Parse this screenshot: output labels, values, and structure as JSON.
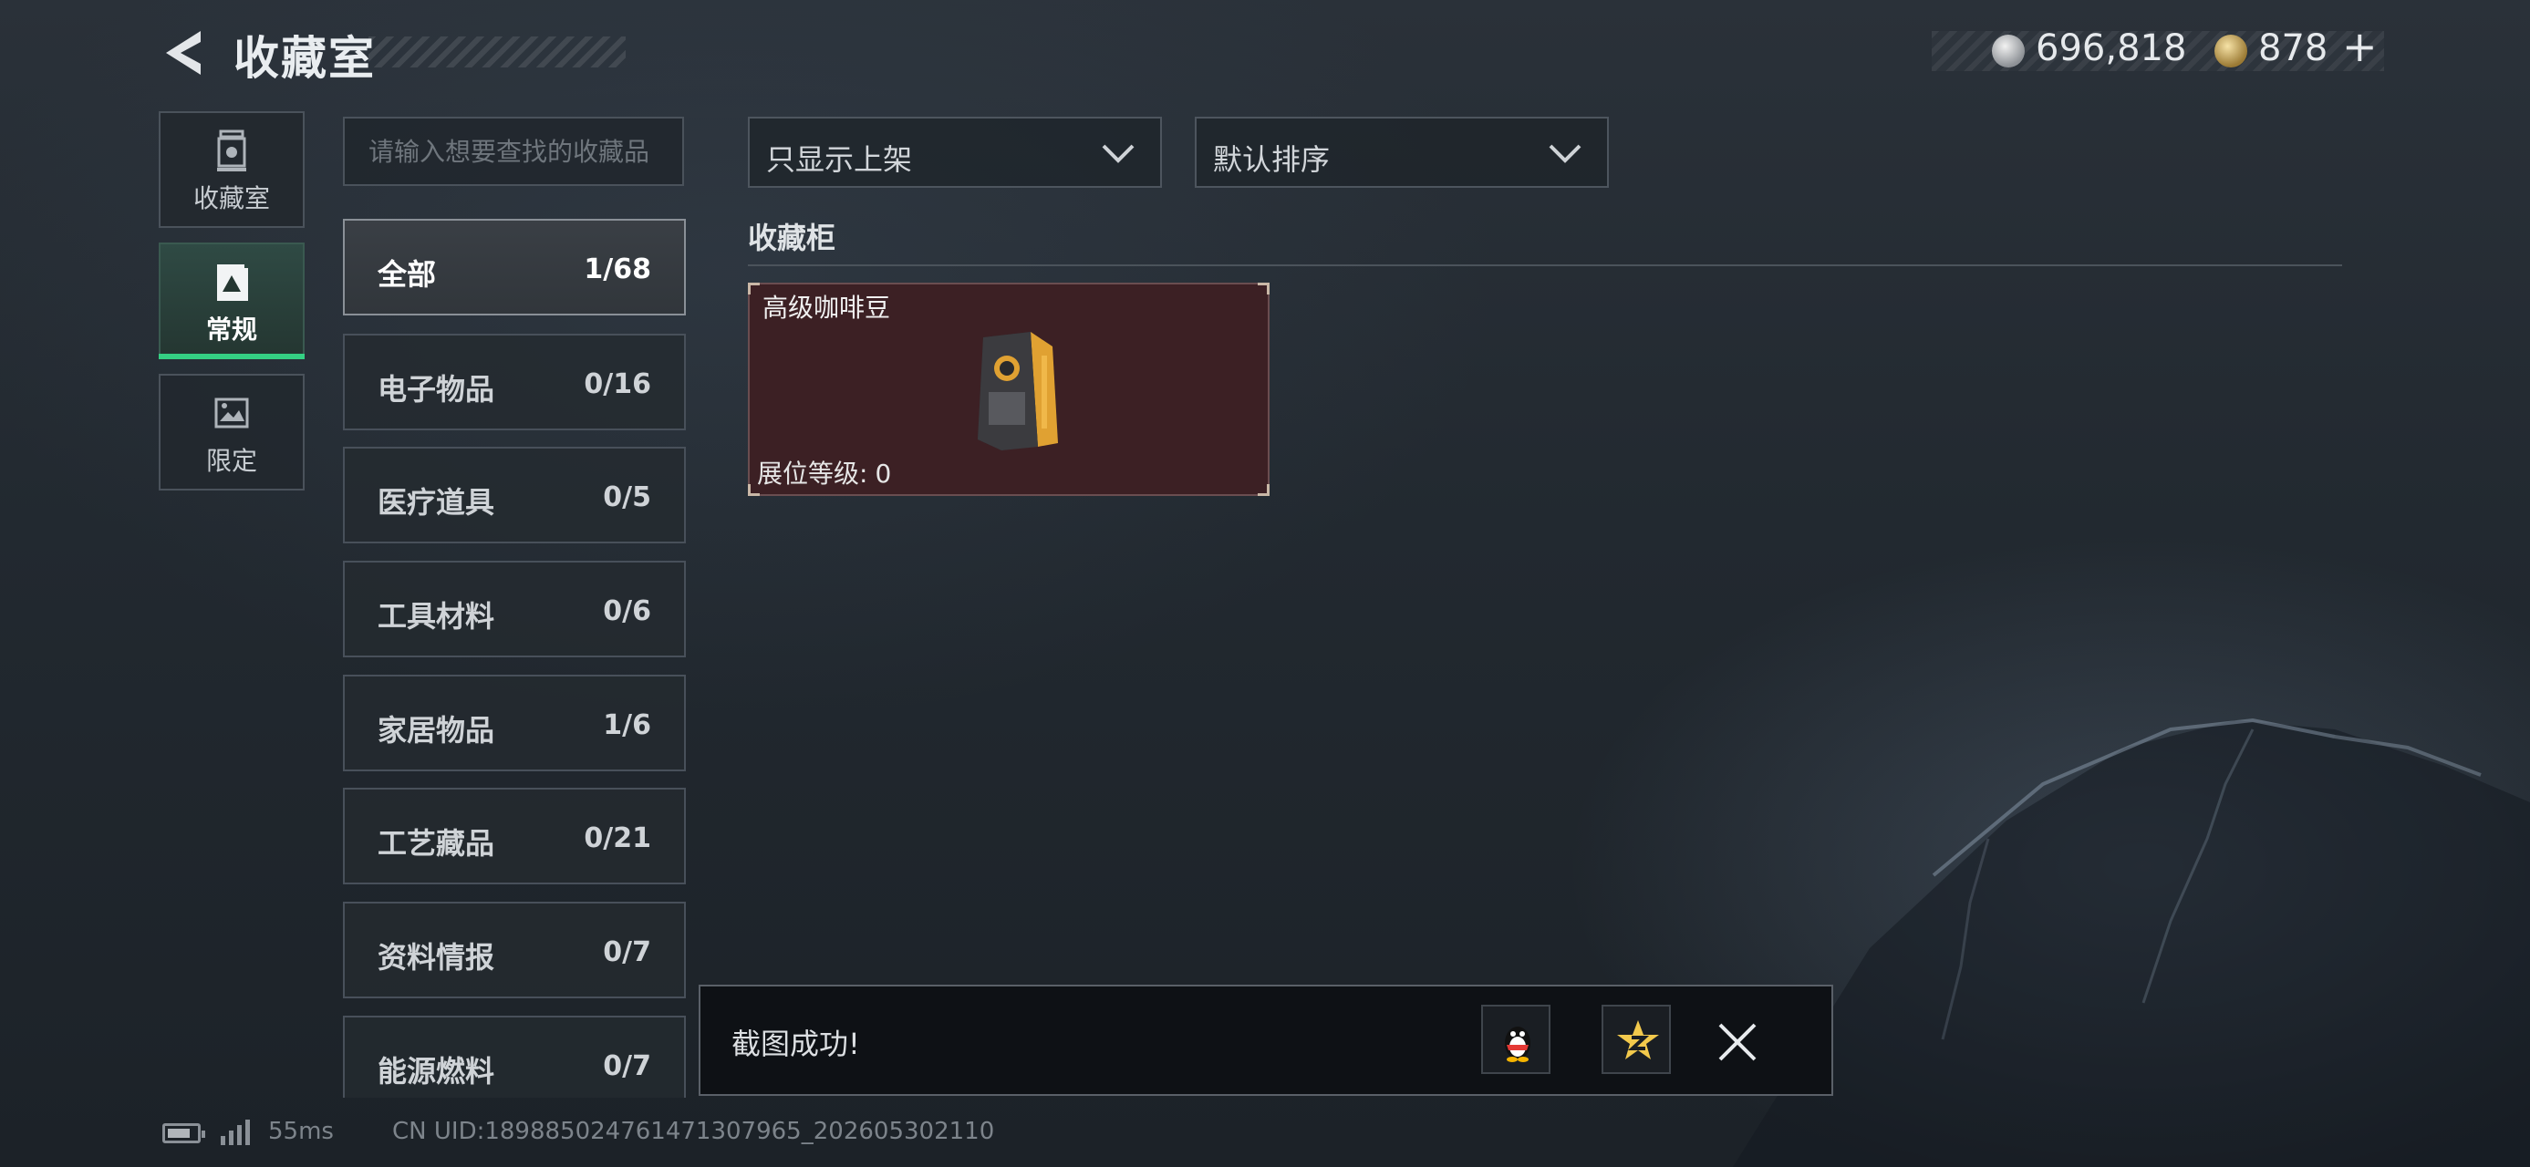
{
  "header": {
    "title": "收藏室",
    "currencies": [
      {
        "icon": "silver-coin-icon",
        "amount": "696,818"
      },
      {
        "icon": "gold-coin-icon",
        "amount": "878"
      }
    ],
    "add_label": "+"
  },
  "sidebar": {
    "items": [
      {
        "label": "收藏室",
        "icon": "trophy-icon",
        "active": false
      },
      {
        "label": "常规",
        "icon": "card-icon",
        "active": true
      },
      {
        "label": "限定",
        "icon": "picture-icon",
        "active": false
      }
    ]
  },
  "search": {
    "placeholder": "请输入想要查找的收藏品"
  },
  "categories": [
    {
      "name": "全部",
      "count": "1/68",
      "active": true
    },
    {
      "name": "电子物品",
      "count": "0/16"
    },
    {
      "name": "医疗道具",
      "count": "0/5"
    },
    {
      "name": "工具材料",
      "count": "0/6"
    },
    {
      "name": "家居物品",
      "count": "1/6"
    },
    {
      "name": "工艺藏品",
      "count": "0/21"
    },
    {
      "name": "资料情报",
      "count": "0/7"
    },
    {
      "name": "能源燃料",
      "count": "0/7"
    }
  ],
  "filters": {
    "display_filter": "只显示上架",
    "sort": "默认排序"
  },
  "section": {
    "title": "收藏柜"
  },
  "items": [
    {
      "name": "高级咖啡豆",
      "level_label": "展位等级:",
      "level_value": "0"
    }
  ],
  "toast": {
    "message": "截图成功!"
  },
  "status": {
    "ping": "55ms",
    "uid": "CN UID:1898850247614713079​65_202605302110"
  },
  "colors": {
    "accent": "#34d083",
    "item_bg": "#3c2024",
    "gold": "#f2c94c"
  }
}
